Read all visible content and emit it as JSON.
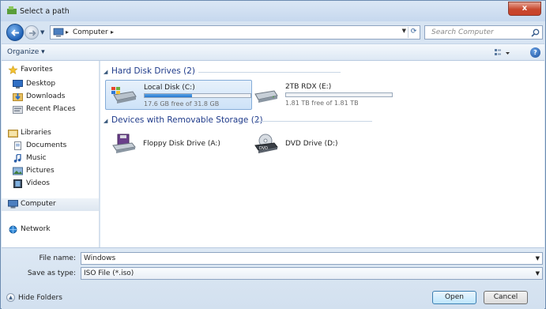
{
  "window": {
    "title": "Select a path",
    "close_label": "x"
  },
  "address_bar": {
    "back_icon": "back-arrow-icon",
    "forward_icon": "forward-arrow-icon",
    "path": "Computer",
    "separator": "▸",
    "search_placeholder": "Search Computer"
  },
  "toolbar": {
    "organize_label": "Organize ▾",
    "help_label": "?"
  },
  "nav": {
    "favorites_label": "Favorites",
    "favorites": [
      "Desktop",
      "Downloads",
      "Recent Places"
    ],
    "libraries_label": "Libraries",
    "libraries": [
      "Documents",
      "Music",
      "Pictures",
      "Videos"
    ],
    "computer_label": "Computer",
    "network_label": "Network"
  },
  "groups": [
    {
      "title": "Hard Disk Drives (2)",
      "drives": [
        {
          "name": "Local Disk (C:)",
          "free_text": "17.6 GB free of 31.8 GB",
          "used_fraction": 0.45,
          "selected": true
        },
        {
          "name": "2TB RDX (E:)",
          "free_text": "1.81 TB free of 1.81 TB",
          "used_fraction": 0.0,
          "selected": false
        }
      ]
    },
    {
      "title": "Devices with Removable Storage (2)",
      "drives": [
        {
          "name": "Floppy Disk Drive (A:)"
        },
        {
          "name": "DVD Drive (D:)"
        }
      ]
    }
  ],
  "bottom": {
    "file_name_label": "File name:",
    "file_name_value": "Windows",
    "save_type_label": "Save as type:",
    "save_type_value": "ISO File (*.iso)",
    "hide_folders_label": "Hide Folders",
    "open_label": "Open",
    "cancel_label": "Cancel"
  },
  "colors": {
    "accent": "#2677cf",
    "group_title": "#1e3a8a",
    "close": "#c8492f"
  }
}
